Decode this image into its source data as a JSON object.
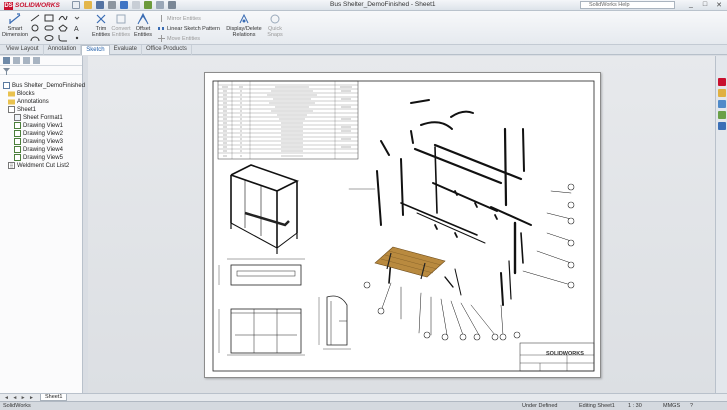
{
  "app": {
    "brand": "SOLIDWORKS",
    "window_title": "Bus Shelter_DemoFinished - Sheet1",
    "help_search_placeholder": "SolidWorks Help",
    "window_buttons": [
      "_",
      "□",
      "✕"
    ]
  },
  "ribbon": {
    "smart_dimension": "Smart Dimension",
    "trim_entities": "Trim Entities",
    "convert_entities": "Convert Entities",
    "offset_entities": "Offset Entities",
    "mirror_entities": "Mirror Entities",
    "linear_sketch_pattern": "Linear Sketch Pattern",
    "move_entities": "Move Entities",
    "display_delete_relations": "Display/Delete Relations",
    "quick_snaps": "Quick Snaps"
  },
  "tabs": [
    "View Layout",
    "Annotation",
    "Sketch",
    "Evaluate",
    "Office Products"
  ],
  "active_tab": "Sketch",
  "tree": {
    "root": "Bus Shelter_DemoFinished",
    "items": [
      "Blocks",
      "Annotations",
      "Sheet1",
      "Sheet Format1",
      "Drawing View1",
      "Drawing View2",
      "Drawing View3",
      "Drawing View4",
      "Drawing View5",
      "Weldment Cut List2"
    ]
  },
  "drawing": {
    "title_block_brand": "SOLIDWORKS"
  },
  "sheet_tabs": {
    "nav": "◄ ◄ ► ►",
    "active": "Sheet1"
  },
  "status": {
    "app": "SolidWorks",
    "state": "Under Defined",
    "editing": "Editing Sheet1",
    "scale": "1 : 30",
    "units": "MMGS",
    "help": "?"
  },
  "colors": {
    "accent": "#1a5aa8",
    "brand": "#c8102e",
    "bench": "#b98a3f"
  },
  "icons": {
    "search": "search-icon",
    "filter": "filter-icon",
    "part": "part-icon",
    "folder": "folder-icon",
    "drawing_view": "drawing-view-icon",
    "sheet": "sheet-icon",
    "cutlist": "cut-list-icon"
  }
}
